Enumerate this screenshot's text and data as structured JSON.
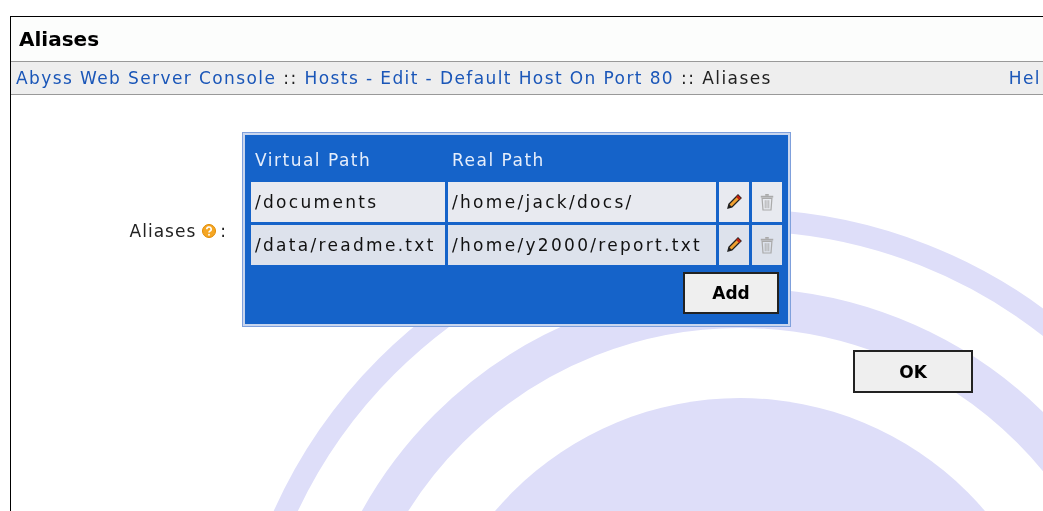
{
  "page": {
    "title": "Aliases"
  },
  "breadcrumb": {
    "items": [
      {
        "label": "Abyss Web Server Console",
        "link": true
      },
      {
        "label": "::",
        "link": false
      },
      {
        "label": "Hosts - Edit - Default Host On Port 80",
        "link": true
      },
      {
        "label": "::",
        "link": false
      },
      {
        "label": "Aliases",
        "link": false
      }
    ],
    "help": "Hel"
  },
  "field": {
    "label": "Aliases",
    "suffix": ":"
  },
  "table": {
    "columns": [
      "Virtual Path",
      "Real Path"
    ],
    "rows": [
      {
        "virtual_path": "/documents",
        "real_path": "/home/jack/docs/"
      },
      {
        "virtual_path": "/data/readme.txt",
        "real_path": "/home/y2000/report.txt"
      }
    ],
    "add_button": "Add"
  },
  "ok_button": "OK"
}
